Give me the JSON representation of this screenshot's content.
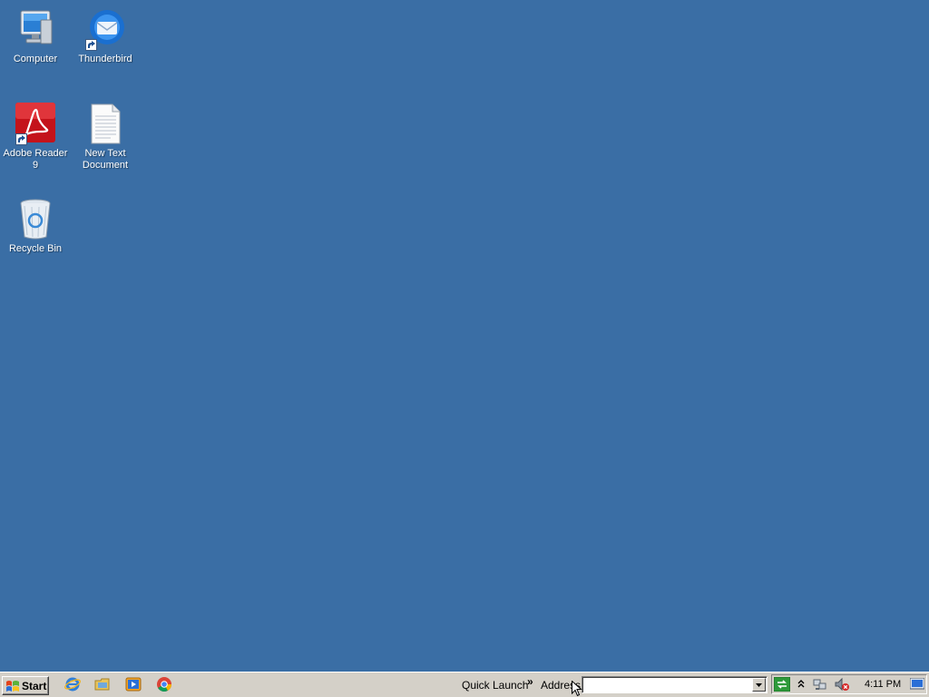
{
  "desktop": {
    "background_color": "#3a6ea5",
    "icons": [
      {
        "label": "Computer",
        "icon": "computer-icon"
      },
      {
        "label": "Thunderbird",
        "icon": "thunderbird-icon"
      },
      {
        "label": "Adobe Reader 9",
        "icon": "adobe-reader-icon"
      },
      {
        "label": "New Text Document",
        "icon": "text-document-icon"
      },
      {
        "label": "Recycle Bin",
        "icon": "recycle-bin-icon"
      }
    ]
  },
  "taskbar": {
    "start_label": "Start",
    "quick_launch_icons": [
      "internet-explorer-icon",
      "folder-icon",
      "media-player-icon",
      "chrome-icon"
    ],
    "quick_launch_label": "Quick Launch",
    "chevron": "»",
    "address_label": "Address",
    "address_value": "",
    "tray_icons": [
      "network-sync-icon",
      "show-hidden-icons-icon",
      "network-icon",
      "volume-muted-icon"
    ],
    "clock": "4:11 PM",
    "desktop_button_icon": "show-desktop-icon"
  }
}
